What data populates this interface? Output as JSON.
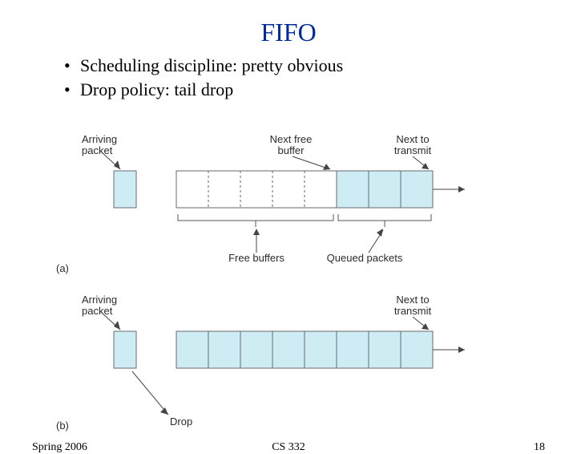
{
  "title": "FIFO",
  "bullets": [
    "Scheduling discipline: pretty obvious",
    "Drop policy: tail drop"
  ],
  "labels": {
    "arriving": "Arriving\npacket",
    "nextfree": "Next free\nbuffer",
    "nexttx": "Next to\ntransmit",
    "freebufs": "Free buffers",
    "queued": "Queued packets",
    "drop": "Drop",
    "a": "(a)",
    "b": "(b)"
  },
  "footer": {
    "left": "Spring 2006",
    "center": "CS 332",
    "right": "18"
  }
}
